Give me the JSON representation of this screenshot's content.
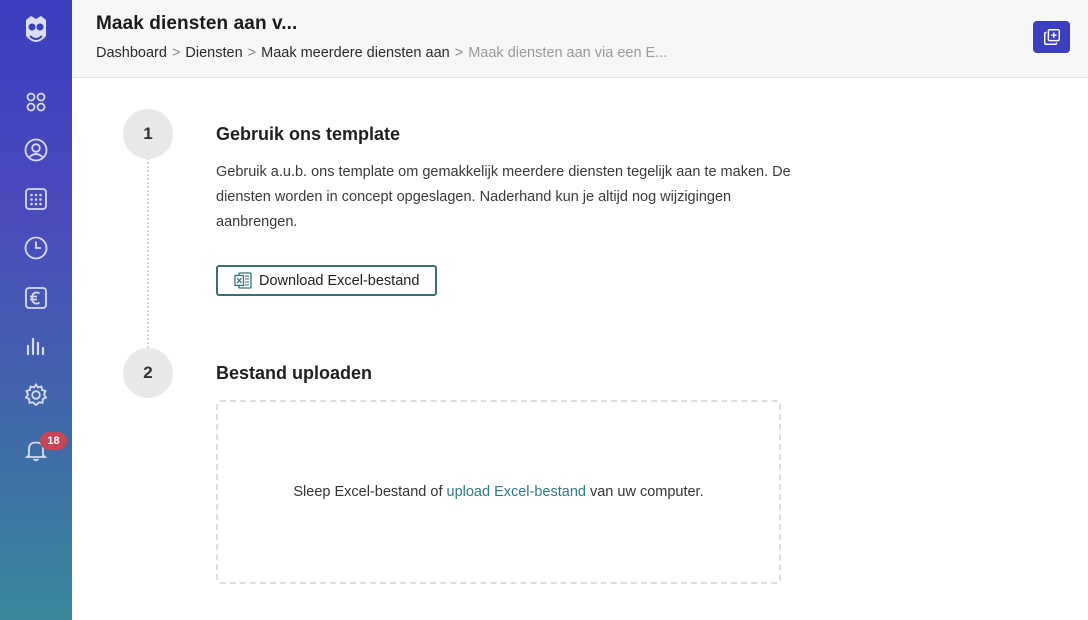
{
  "header": {
    "title": "Maak diensten aan v...",
    "breadcrumb": [
      "Dashboard",
      "Diensten",
      "Maak meerdere diensten aan",
      "Maak diensten aan via een E..."
    ],
    "separator": ">"
  },
  "sidebar": {
    "items": [
      {
        "icon": "apps-icon"
      },
      {
        "icon": "user-circle-icon"
      },
      {
        "icon": "calendar-grid-icon"
      },
      {
        "icon": "clock-icon"
      },
      {
        "icon": "euro-icon"
      },
      {
        "icon": "bar-chart-icon"
      },
      {
        "icon": "gear-icon"
      },
      {
        "icon": "bell-icon",
        "badge": "18"
      }
    ]
  },
  "steps": [
    {
      "number": "1",
      "title": "Gebruik ons template",
      "text": "Gebruik a.u.b. ons template om gemakkelijk meerdere diensten tegelijk aan te maken. De diensten worden in concept opgeslagen. Naderhand kun je altijd nog wijzigingen aanbrengen.",
      "button_label": "Download Excel-bestand"
    },
    {
      "number": "2",
      "title": "Bestand uploaden",
      "dropzone_prefix": "Sleep Excel-bestand of",
      "dropzone_link": "upload Excel-bestand",
      "dropzone_suffix": "van uw computer."
    }
  ],
  "colors": {
    "sidebar_top": "#3b3fbf",
    "sidebar_bottom": "#3a8a9c",
    "accent": "#3b3fbf",
    "link": "#2f7a86",
    "badge": "#c8455a"
  }
}
